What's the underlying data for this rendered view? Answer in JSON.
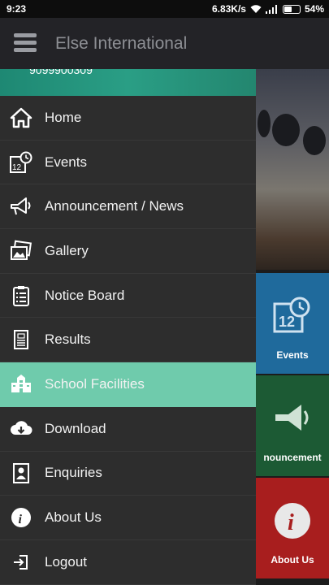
{
  "status_bar": {
    "time": "9:23",
    "network_speed": "6.83K/s",
    "battery": "54%",
    "battery_level": 0.54
  },
  "toolbar": {
    "title": "Else International"
  },
  "drawer": {
    "header_phone": "9099900309",
    "items": [
      {
        "label": "Home",
        "icon": "home-icon"
      },
      {
        "label": "Events",
        "icon": "calendar-icon"
      },
      {
        "label": "Announcement / News",
        "icon": "megaphone-icon"
      },
      {
        "label": "Gallery",
        "icon": "gallery-icon"
      },
      {
        "label": "Notice Board",
        "icon": "clipboard-icon"
      },
      {
        "label": "Results",
        "icon": "results-icon"
      },
      {
        "label": "School Facilities",
        "icon": "building-icon",
        "active": true
      },
      {
        "label": "Download",
        "icon": "cloud-download-icon"
      },
      {
        "label": "Enquiries",
        "icon": "enquiry-icon"
      },
      {
        "label": "About Us",
        "icon": "info-icon"
      },
      {
        "label": "Logout",
        "icon": "logout-icon"
      }
    ]
  },
  "background_tiles": {
    "events": {
      "label": "Events",
      "color": "#1f6a9c"
    },
    "announcement": {
      "label": "nouncement",
      "color": "#1c5a34"
    },
    "about": {
      "label": "About Us",
      "color": "#a81e1e"
    }
  },
  "colors": {
    "drawer_bg": "#2d2d2d",
    "active_item": "#6fcbac",
    "toolbar_bg": "#232327"
  }
}
